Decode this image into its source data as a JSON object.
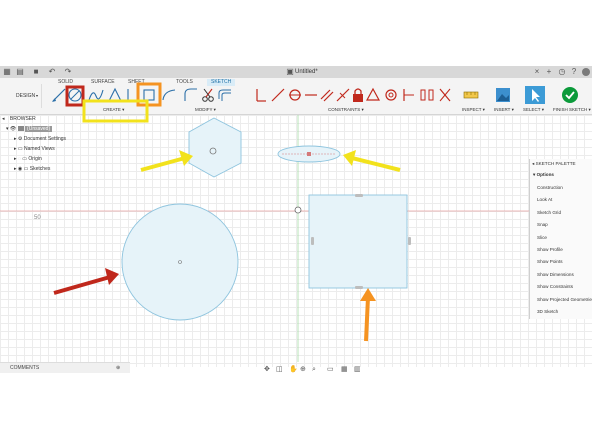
{
  "window": {
    "title": "Untitled*"
  },
  "toolbar": {
    "workspace": "DESIGN",
    "tabs": [
      "SOLID",
      "SURFACE",
      "SHEET",
      "TOOLS",
      "SKETCH"
    ],
    "active_tab": "SKETCH",
    "groups": {
      "create": "CREATE",
      "modify": "MODIFY",
      "constraints": "CONSTRAINTS",
      "inspect": "INSPECT",
      "insert": "INSERT",
      "select": "SELECT",
      "finish": "FINISH SKETCH"
    },
    "accent": "#1b7fc4",
    "finish_color": "#0b9a3a"
  },
  "browser": {
    "title": "BROWSER",
    "root": "(Unsaved)",
    "items": [
      "Document Settings",
      "Named Views",
      "Origin",
      "Sketches"
    ]
  },
  "canvas": {
    "axis_label_left": "50",
    "axis_label_mid": "50",
    "sketch_stroke": "#8ec4de",
    "sketch_fill": "#e6f3f9"
  },
  "palette": {
    "title": "SKETCH PALETTE",
    "section": "Options",
    "items": [
      "Construction",
      "Look At",
      "Sketch Grid",
      "Snap",
      "Slice",
      "Show Profile",
      "Show Points",
      "Show Dimensions",
      "Show Constraints",
      "Show Projected Geometries",
      "3D Sketch"
    ]
  },
  "comments": {
    "label": "COMMENTS"
  },
  "annotations": {
    "red": "#c0281c",
    "orange": "#f59321",
    "yellow": "#f2e21c"
  }
}
